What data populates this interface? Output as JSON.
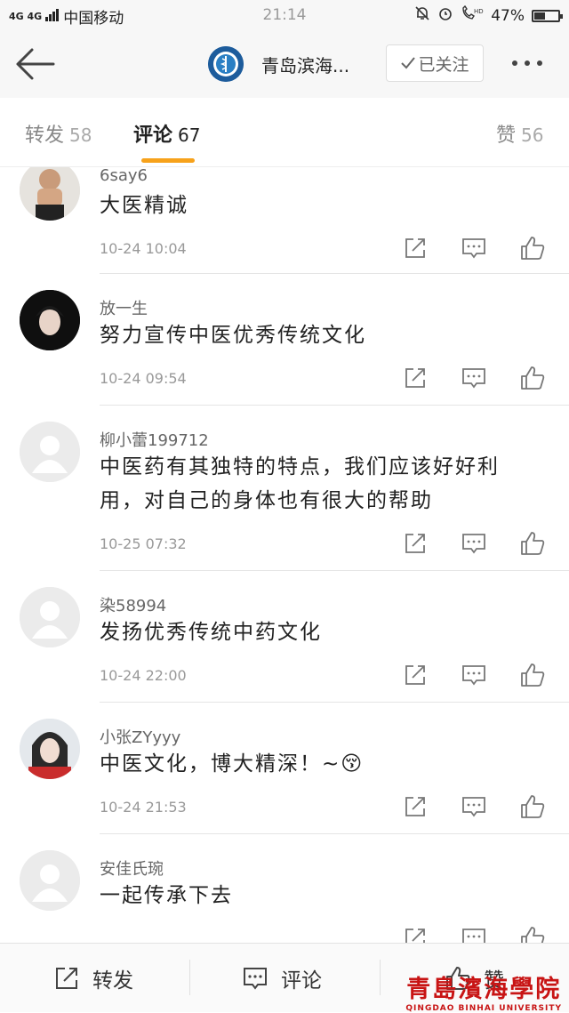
{
  "status_bar": {
    "signal": "4G 4G",
    "carrier": "中国移动",
    "time": "21:14",
    "battery": "47%",
    "battery_level": 0.47
  },
  "nav": {
    "title": "青岛滨海...",
    "follow_label": "已关注"
  },
  "tabs": [
    {
      "label": "转发",
      "count": "58"
    },
    {
      "label": "评论",
      "count": "67"
    },
    {
      "label": "赞",
      "count": "56"
    }
  ],
  "comments": [
    {
      "user": "6say6",
      "text": [
        "大医精诚"
      ],
      "time": "10-24 10:04"
    },
    {
      "user": "放一生",
      "text": [
        "努力宣传中医优秀传统文化"
      ],
      "time": "10-24 09:54"
    },
    {
      "user": "柳小蕾199712",
      "text": [
        "中医药有其独特的特点，我们应该好好利",
        "用，对自己的身体也有很大的帮助"
      ],
      "time": "10-25 07:32"
    },
    {
      "user": "染58994",
      "text": [
        "发扬优秀传统中药文化"
      ],
      "time": "10-24 22:00"
    },
    {
      "user": "小张ZYyyy",
      "text": [
        "中医文化，博大精深！~😚"
      ],
      "time": "10-24 21:53"
    },
    {
      "user": "安佳氏琬",
      "text": [
        "一起传承下去"
      ],
      "time": ""
    }
  ],
  "bottom": {
    "repost": "转发",
    "comment": "评论",
    "like": "赞"
  },
  "watermark": {
    "main": "青島濱海學院",
    "sub": "QINGDAO BINHAI UNIVERSITY"
  },
  "colors": {
    "accent": "#f7a21b",
    "watermark": "#c81414"
  }
}
